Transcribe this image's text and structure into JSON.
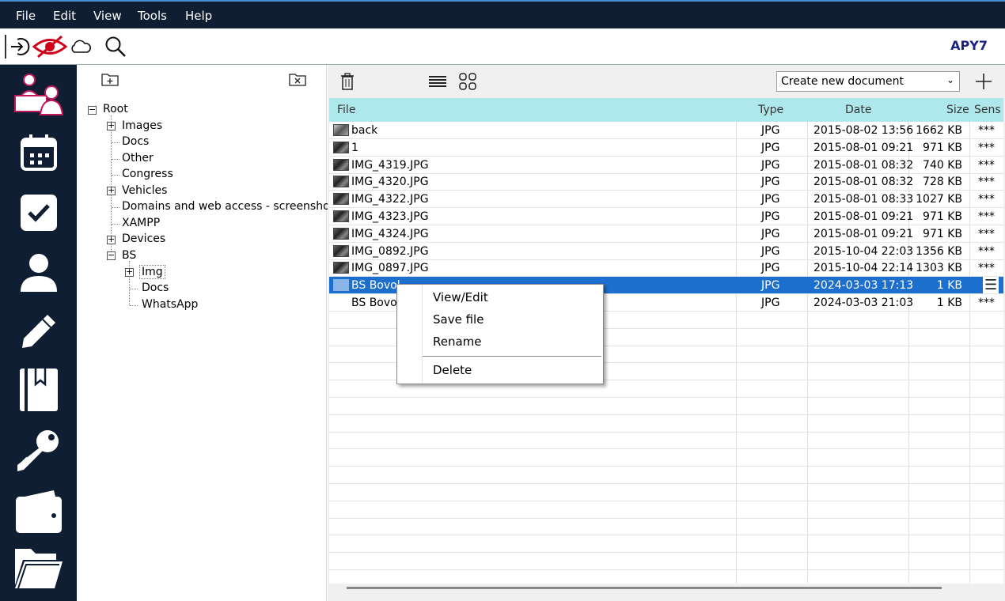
{
  "menu": [
    "File",
    "Edit",
    "View",
    "Tools",
    "Help"
  ],
  "toolbar": {
    "icons": [
      "logout-icon",
      "hidden-eye-icon",
      "cloud-icon",
      "search-icon"
    ],
    "brand": "APY7",
    "accent": "#d0021b"
  },
  "nav": [
    "contacts-icon",
    "calendar-icon",
    "tasks-icon",
    "user-icon",
    "edit-icon",
    "bookmark-book-icon",
    "key-icon",
    "wallet-icon",
    "folder-open-icon"
  ],
  "tree": {
    "root": "Root",
    "items": [
      {
        "label": "Images",
        "expandable": true
      },
      {
        "label": "Docs",
        "expandable": false
      },
      {
        "label": "Other",
        "expandable": false
      },
      {
        "label": "Congress",
        "expandable": false
      },
      {
        "label": "Vehicles",
        "expandable": true
      },
      {
        "label": "Domains and web access - screenshots",
        "expandable": false
      },
      {
        "label": "XAMPP",
        "expandable": false
      },
      {
        "label": "Devices",
        "expandable": true
      },
      {
        "label": "BS",
        "expandable": "open"
      },
      {
        "label": "Img",
        "expandable": true
      },
      {
        "label": "Docs",
        "expandable": false
      },
      {
        "label": "WhatsApp",
        "expandable": false
      }
    ]
  },
  "content": {
    "create_select": "Create new document",
    "columns": [
      "File",
      "Type",
      "Date",
      "Size",
      "Sens"
    ],
    "rows": [
      {
        "file": "back",
        "type": "JPG",
        "date": "2015-08-02 13:56",
        "size": "1662 KB",
        "sens": "***"
      },
      {
        "file": "1",
        "type": "JPG",
        "date": "2015-08-01 09:21",
        "size": "971 KB",
        "sens": "***"
      },
      {
        "file": "IMG_4319.JPG",
        "type": "JPG",
        "date": "2015-08-01 08:32",
        "size": "740 KB",
        "sens": "***"
      },
      {
        "file": "IMG_4320.JPG",
        "type": "JPG",
        "date": "2015-08-01 08:32",
        "size": "728 KB",
        "sens": "***"
      },
      {
        "file": "IMG_4322.JPG",
        "type": "JPG",
        "date": "2015-08-01 08:33",
        "size": "1027 KB",
        "sens": "***"
      },
      {
        "file": "IMG_4323.JPG",
        "type": "JPG",
        "date": "2015-08-01 09:21",
        "size": "971 KB",
        "sens": "***"
      },
      {
        "file": "IMG_4324.JPG",
        "type": "JPG",
        "date": "2015-08-01 09:21",
        "size": "971 KB",
        "sens": "***"
      },
      {
        "file": "IMG_0892.JPG",
        "type": "JPG",
        "date": "2015-10-04 22:03",
        "size": "1356 KB",
        "sens": "***"
      },
      {
        "file": "IMG_0897.JPG",
        "type": "JPG",
        "date": "2015-10-04 22:14",
        "size": "1303 KB",
        "sens": "***"
      },
      {
        "file": "BS Bovol",
        "type": "JPG",
        "date": "2024-03-03 17:13",
        "size": "1 KB",
        "sens": ""
      },
      {
        "file": "BS Bovol",
        "type": "JPG",
        "date": "2024-03-03 21:03",
        "size": "1 KB",
        "sens": "***"
      }
    ]
  },
  "context_menu": [
    "View/Edit",
    "Save file",
    "Rename",
    "Delete"
  ]
}
